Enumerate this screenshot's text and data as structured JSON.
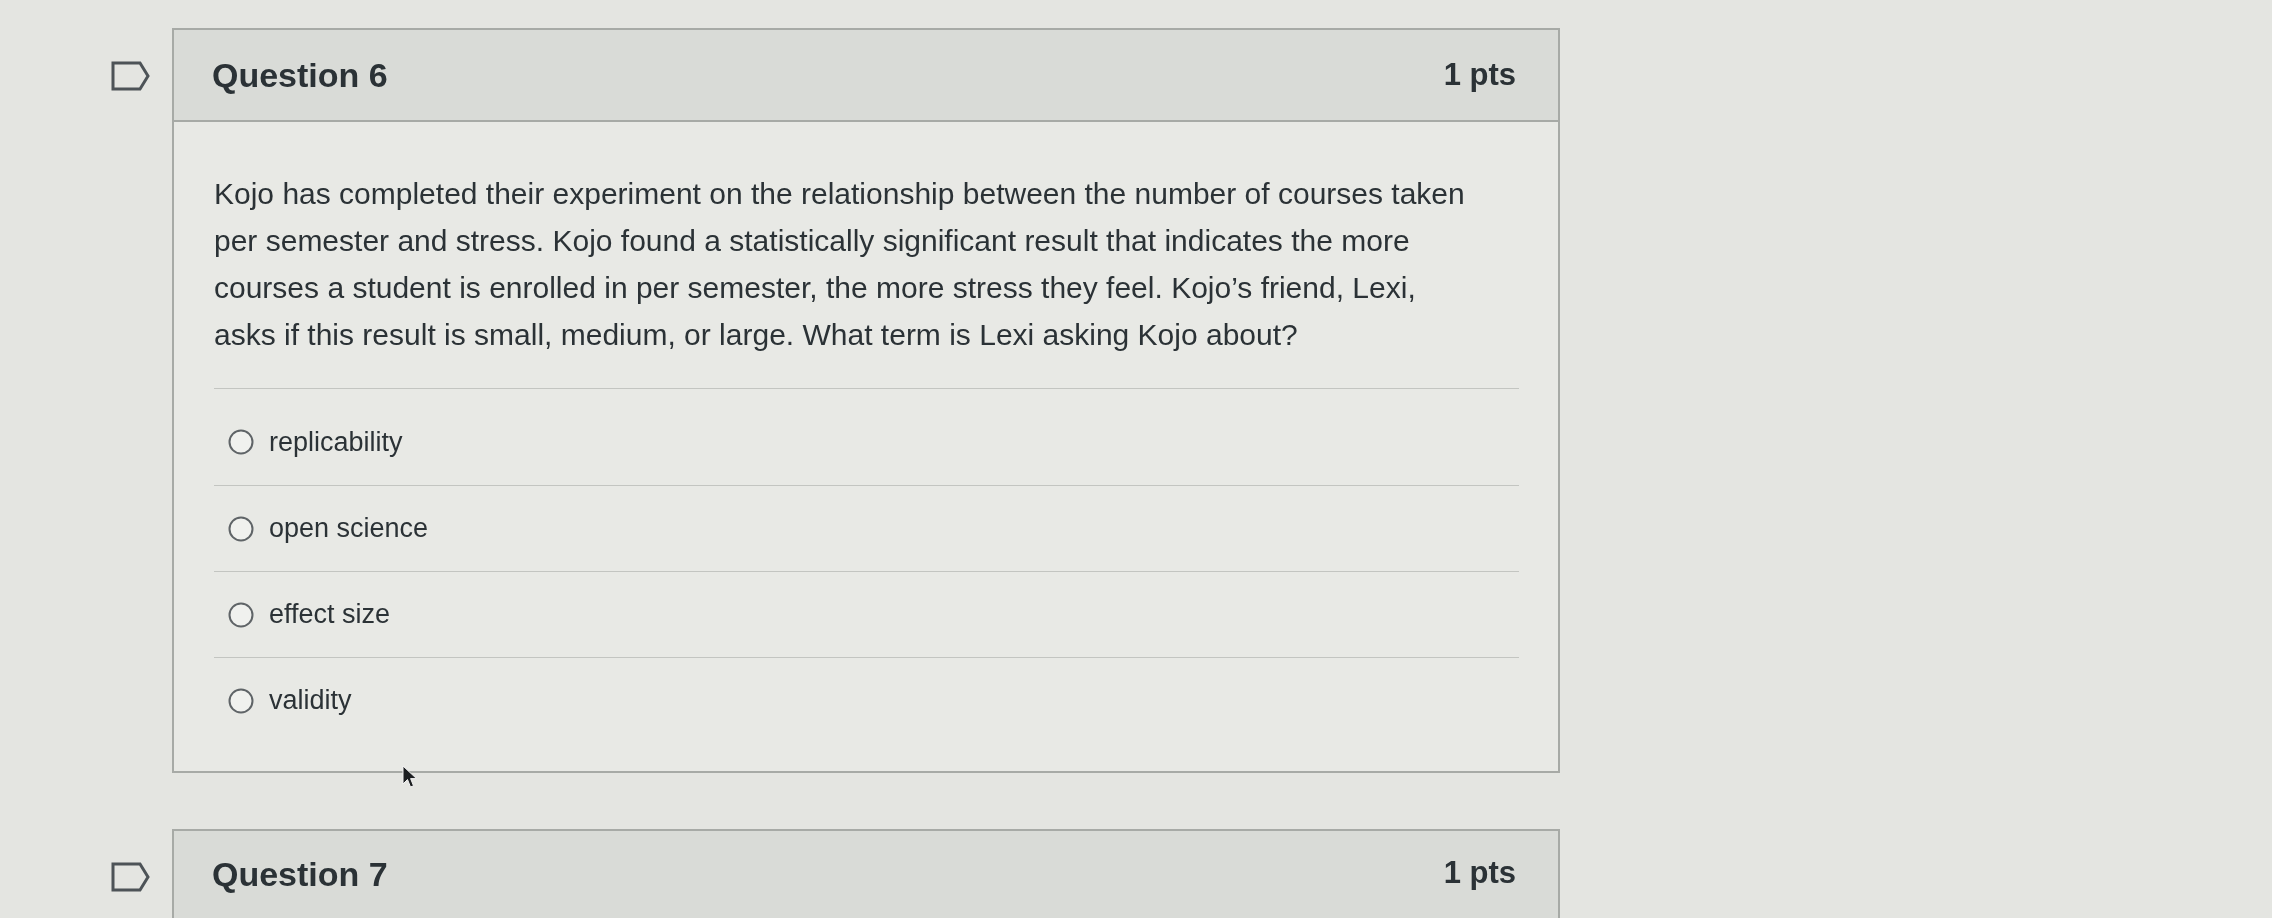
{
  "questions": [
    {
      "title": "Question 6",
      "points": "1 pts",
      "flagged": false,
      "text": "Kojo has completed their experiment on the relationship between the number of courses taken per semester and stress. Kojo found a statistically significant result that indicates the more courses a student is enrolled in per semester, the more stress they feel. Kojo’s friend, Lexi, asks if this result is small, medium, or large. What term is Lexi asking Kojo about?",
      "answers": [
        {
          "label": "replicability",
          "selected": false
        },
        {
          "label": "open science",
          "selected": false
        },
        {
          "label": "effect size",
          "selected": false
        },
        {
          "label": "validity",
          "selected": false
        }
      ]
    },
    {
      "title": "Question 7",
      "points": "1 pts",
      "flagged": false
    }
  ]
}
